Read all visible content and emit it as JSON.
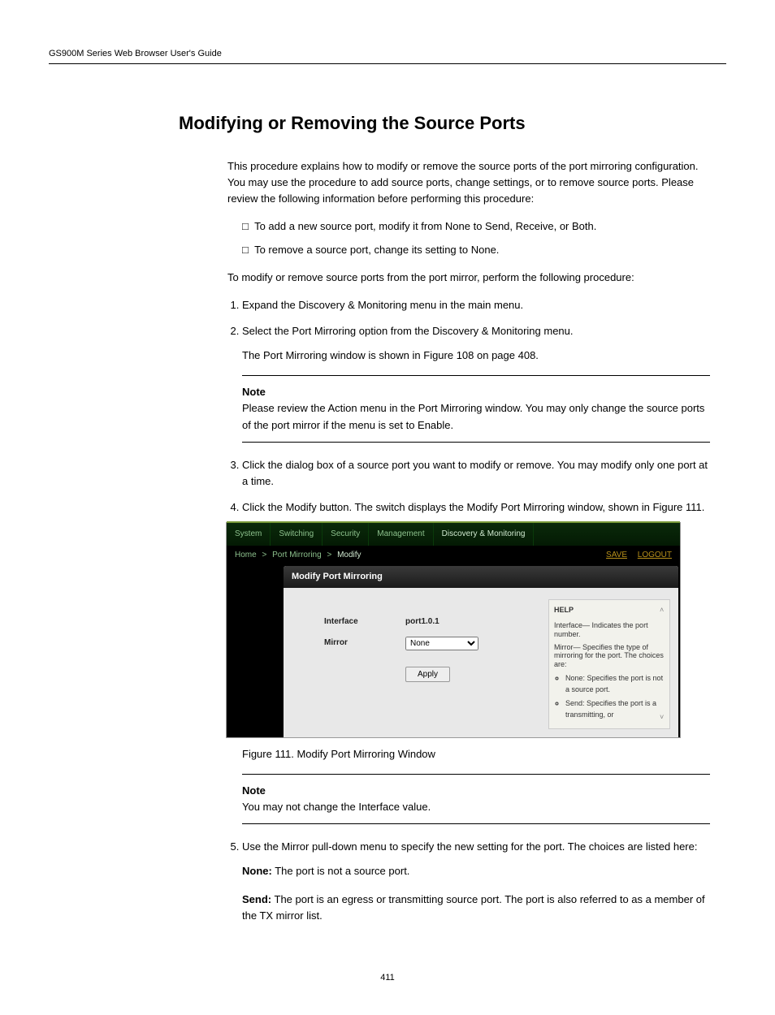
{
  "header": {
    "left": "GS900M Series Web Browser User's Guide"
  },
  "section_title": "Modifying or Removing the Source Ports",
  "intro": "This procedure explains how to modify or remove the source ports of the port mirroring configuration. You may use the procedure to add source ports, change settings, or to remove source ports. Please review the following information before performing this procedure:",
  "bullets": [
    "To add a new source port, modify it from None to Send, Receive, or Both.",
    "To remove a source port, change its setting to None."
  ],
  "steps_intro": "To modify or remove source ports from the port mirror, perform the following procedure:",
  "step1": "Expand the Discovery & Monitoring menu in the main menu.",
  "step2": "Select the Port Mirroring option from the Discovery & Monitoring menu.",
  "step2_sub": "The Port Mirroring window is shown in Figure 108 on page 408.",
  "note_label": "Note",
  "note1_text": "Please review the Action menu in the Port Mirroring window. You may only change the source ports of the port mirror if the menu is set to Enable.",
  "step3_a": "Click the dialog box of a source port you want to modify or remove. You may modify only one port at a time.",
  "step3_b": "Click the Modify button. The switch displays the Modify Port Mirroring window, shown in Figure 111.",
  "figure_caption": "Figure 111. Modify Port Mirroring Window",
  "note2_text": "You may not change the Interface value.",
  "step5_a": "Use the Mirror pull-down menu to specify the new setting for the port. The choices are listed here:",
  "opt_none_label": "None:",
  "opt_none_text": " The port is not a source port.",
  "opt_send_label": "Send:",
  "opt_send_text": " The port is an egress or transmitting source port. The port is also referred to as a member of the TX mirror list.",
  "page_number": "411",
  "screenshot": {
    "tabs": [
      "System",
      "Switching",
      "Security",
      "Management",
      "Discovery & Monitoring"
    ],
    "breadcrumb": [
      "Home",
      ">",
      "Port Mirroring",
      ">",
      "Modify"
    ],
    "save": "SAVE",
    "logout": "LOGOUT",
    "panel_title": "Modify Port Mirroring",
    "interface_label": "Interface",
    "interface_value": "port1.0.1",
    "mirror_label": "Mirror",
    "mirror_value": "None",
    "apply": "Apply",
    "help_title": "HELP",
    "help_interface": "Interface— Indicates the port number.",
    "help_mirror": "Mirror— Specifies the type of mirroring for the port. The choices are:",
    "help_li1": "None: Specifies the port is not a source port.",
    "help_li2": "Send: Specifies the port is a transmitting, or"
  }
}
